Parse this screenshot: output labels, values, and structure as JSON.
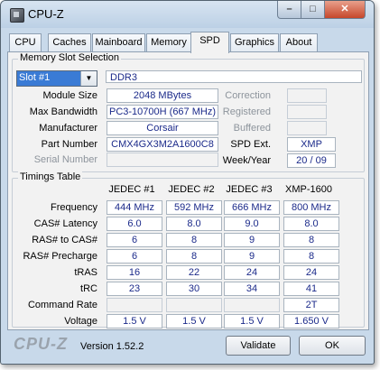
{
  "window": {
    "title": "CPU-Z"
  },
  "title_buttons": {
    "minimize": "–",
    "maximize": "□",
    "close": "✕"
  },
  "tabs": [
    "CPU",
    "Caches",
    "Mainboard",
    "Memory",
    "SPD",
    "Graphics",
    "About"
  ],
  "active_tab": "SPD",
  "memory_slot": {
    "title": "Memory Slot Selection",
    "slot": "Slot #1",
    "type": "DDR3",
    "labels": {
      "module_size": "Module Size",
      "max_bandwidth": "Max Bandwidth",
      "manufacturer": "Manufacturer",
      "part_number": "Part Number",
      "serial_number": "Serial Number",
      "correction": "Correction",
      "registered": "Registered",
      "buffered": "Buffered",
      "spd_ext": "SPD Ext.",
      "week_year": "Week/Year"
    },
    "values": {
      "module_size": "2048 MBytes",
      "max_bandwidth": "PC3-10700H (667 MHz)",
      "manufacturer": "Corsair",
      "part_number": "CMX4GX3M2A1600C8",
      "serial_number": "",
      "correction": "",
      "registered": "",
      "buffered": "",
      "spd_ext": "XMP",
      "week_year": "20 / 09"
    }
  },
  "timings": {
    "title": "Timings Table",
    "columns": [
      "JEDEC #1",
      "JEDEC #2",
      "JEDEC #3",
      "XMP-1600"
    ],
    "rows": [
      {
        "label": "Frequency",
        "values": [
          "444 MHz",
          "592 MHz",
          "666 MHz",
          "800 MHz"
        ]
      },
      {
        "label": "CAS# Latency",
        "values": [
          "6.0",
          "8.0",
          "9.0",
          "8.0"
        ]
      },
      {
        "label": "RAS# to CAS#",
        "values": [
          "6",
          "8",
          "9",
          "8"
        ]
      },
      {
        "label": "RAS# Precharge",
        "values": [
          "6",
          "8",
          "9",
          "8"
        ]
      },
      {
        "label": "tRAS",
        "values": [
          "16",
          "22",
          "24",
          "24"
        ]
      },
      {
        "label": "tRC",
        "values": [
          "23",
          "30",
          "34",
          "41"
        ]
      },
      {
        "label": "Command Rate",
        "values": [
          "",
          "",
          "",
          "2T"
        ]
      },
      {
        "label": "Voltage",
        "values": [
          "1.5 V",
          "1.5 V",
          "1.5 V",
          "1.650 V"
        ]
      }
    ]
  },
  "footer": {
    "logo": "CPU-Z",
    "version": "Version 1.52.2",
    "validate": "Validate",
    "ok": "OK"
  }
}
